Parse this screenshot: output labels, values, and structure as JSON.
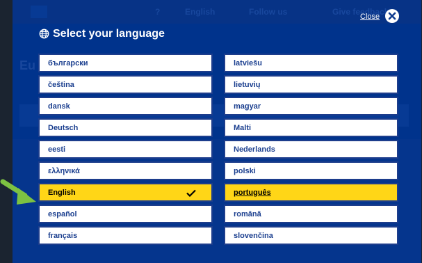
{
  "background": {
    "language_label": "English",
    "follow_label": "Follow us",
    "feedback_label": "Give feedback",
    "page_heading": "Eu"
  },
  "overlay": {
    "close_label": "Close",
    "title": "Select your language"
  },
  "languages": {
    "left": [
      {
        "label": "български"
      },
      {
        "label": "čeština"
      },
      {
        "label": "dansk"
      },
      {
        "label": "Deutsch"
      },
      {
        "label": "eesti"
      },
      {
        "label": "ελληνικά"
      },
      {
        "label": "English"
      },
      {
        "label": "español"
      },
      {
        "label": "français"
      }
    ],
    "right": [
      {
        "label": "latviešu"
      },
      {
        "label": "lietuvių"
      },
      {
        "label": "magyar"
      },
      {
        "label": "Malti"
      },
      {
        "label": "Nederlands"
      },
      {
        "label": "polski"
      },
      {
        "label": "português"
      },
      {
        "label": "română"
      },
      {
        "label": "slovenčina"
      }
    ]
  },
  "selected_language": "English",
  "colors": {
    "accent_yellow": "#ffd617",
    "eu_blue": "#003a9a",
    "pointer_green": "#7dc242"
  }
}
